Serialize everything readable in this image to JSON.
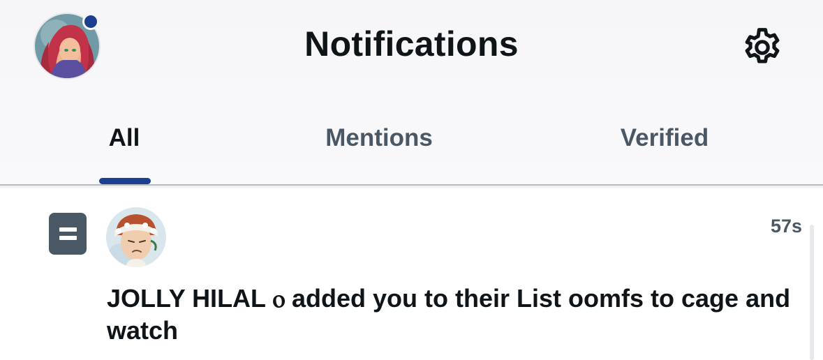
{
  "header": {
    "title": "Notifications",
    "has_unread_dot": true,
    "accent_color": "#1d3f8f"
  },
  "icons": {
    "profile": "user-avatar",
    "settings": "gear-icon",
    "list": "list-icon"
  },
  "tabs": [
    {
      "label": "All",
      "active": true
    },
    {
      "label": "Mentions",
      "active": false
    },
    {
      "label": "Verified",
      "active": false
    }
  ],
  "notifications": [
    {
      "type": "list-added",
      "timestamp": "57s",
      "sender": "JOLLY HILAL ͦ̅",
      "sender_display": "JOLLY HILAL ᾥ",
      "text_sender": "JOLLY HILAL ",
      "text_symbol": "ⲟ",
      "text_rest": " added you to their List oomfs to cage and watch"
    }
  ]
}
